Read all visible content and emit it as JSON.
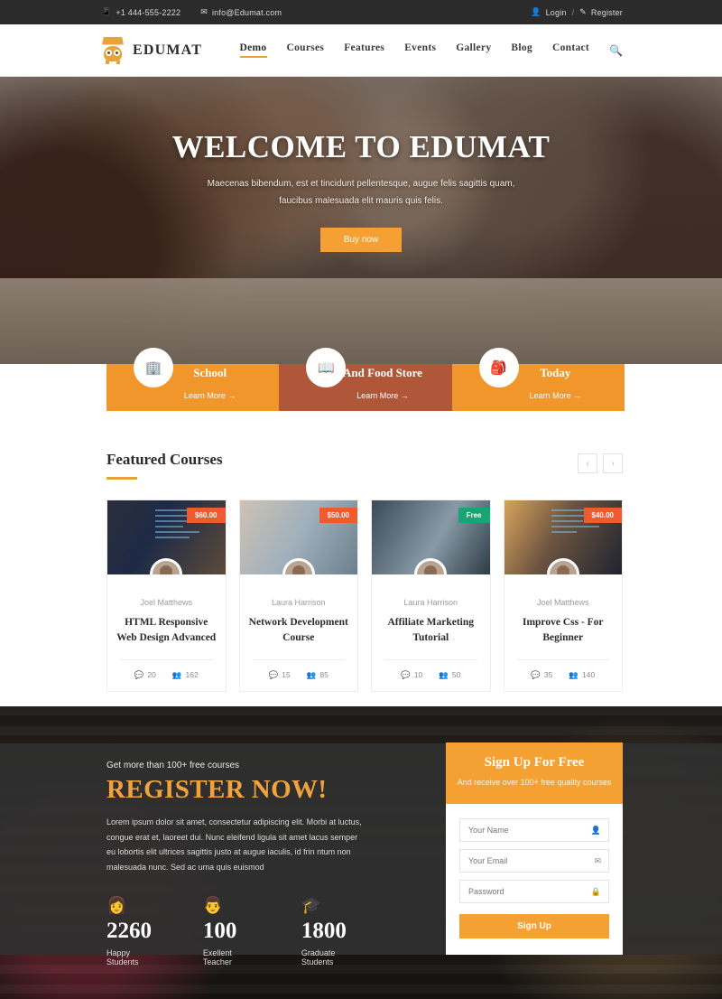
{
  "topbar": {
    "phone": "+1 444-555-2222",
    "email": "info@Edumat.com",
    "phone_icon": "phone-icon",
    "email_icon": "envelope-icon",
    "login": "Login",
    "separator": "/",
    "register": "Register"
  },
  "header": {
    "brand": "EDUMAT",
    "logo_icon": "owl-logo-icon",
    "nav": [
      {
        "label": "Demo",
        "active": true
      },
      {
        "label": "Courses",
        "active": false
      },
      {
        "label": "Features",
        "active": false
      },
      {
        "label": "Events",
        "active": false
      },
      {
        "label": "Gallery",
        "active": false
      },
      {
        "label": "Blog",
        "active": false
      },
      {
        "label": "Contact",
        "active": false
      }
    ],
    "search_icon": "search-icon"
  },
  "hero": {
    "title": "WELCOME TO EDUMAT",
    "subtitle": "Maecenas bibendum, est et tincidunt pellentesque, augue felis sagittis quam, faucibus malesuada elit mauris quis felis.",
    "cta": "Buy now"
  },
  "info_cards": [
    {
      "title": "School",
      "link": "Learn More",
      "arrow": "→",
      "icon": "school-building-icon",
      "color": "#f0962a"
    },
    {
      "title": "And Food Store",
      "link": "Learn More",
      "arrow": "→",
      "icon": "books-icon",
      "color": "#b0573a"
    },
    {
      "title": "Today",
      "link": "Learn More",
      "arrow": "→",
      "icon": "backpack-icon",
      "color": "#f0962a"
    }
  ],
  "featured": {
    "title": "Featured Courses",
    "prev_icon": "chevron-left-icon",
    "next_icon": "chevron-right-icon",
    "comment_icon": "comment-icon",
    "students_icon": "users-icon",
    "courses": [
      {
        "price": "$60.00",
        "free": false,
        "author": "Joel Matthews",
        "name": "HTML Responsive Web Design Advanced",
        "comments": "20",
        "students": "162"
      },
      {
        "price": "$50.00",
        "free": false,
        "author": "Laura Harrison",
        "name": "Network Development Course",
        "comments": "15",
        "students": "85"
      },
      {
        "price": "Free",
        "free": true,
        "author": "Laura Harrison",
        "name": "Affiliate Marketing Tutorial",
        "comments": "10",
        "students": "50"
      },
      {
        "price": "$40.00",
        "free": false,
        "author": "Joel Matthews",
        "name": "Improve Css - For Beginner",
        "comments": "35",
        "students": "140"
      }
    ]
  },
  "register": {
    "kicker": "Get more than 100+ free courses",
    "title": "REGISTER NOW!",
    "text": "Lorem ipsum dolor sit amet, consectetur adipiscing elit. Morbi at luctus, congue erat et, laoreet dui. Nunc eleifend ligula sit amet lacus semper eu lobortis elit ultrices sagittis justo at augue iaculis, id frin ntum non malesuada nunc. Sed ac uma quis euismod",
    "stats": [
      {
        "icon": "student-icon",
        "number": "2260",
        "label": "Happy Students"
      },
      {
        "icon": "teacher-icon",
        "number": "100",
        "label": "Exellent Teacher"
      },
      {
        "icon": "graduation-cap-icon",
        "number": "1800",
        "label": "Graduate Students"
      }
    ]
  },
  "signup": {
    "title": "Sign Up For Free",
    "subtitle": "And receive over 100+ free quality courses",
    "fields": [
      {
        "placeholder": "Your Name",
        "icon": "user-icon",
        "value": ""
      },
      {
        "placeholder": "Your Email",
        "icon": "envelope-icon",
        "value": ""
      },
      {
        "placeholder": "Password",
        "icon": "lock-icon",
        "value": ""
      }
    ],
    "button": "Sign Up"
  },
  "colors": {
    "accent_orange": "#f5a033",
    "brand_gold": "#e8a33d",
    "card_brown": "#b0573a",
    "price_red": "#ef5a31",
    "free_green": "#17a673",
    "dark": "#2b2b2b"
  }
}
